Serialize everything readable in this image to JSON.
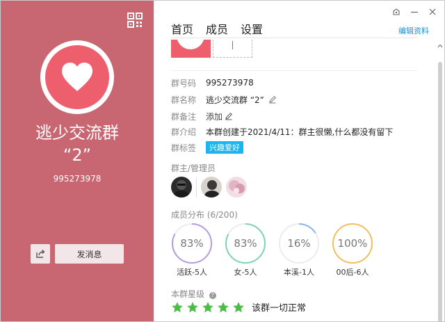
{
  "left": {
    "group_name": "逃少交流群\n“2”",
    "group_id": "995273978",
    "send_message_label": "发消息",
    "panel_color": "#c86671",
    "avatar_color": "#ee5f6e"
  },
  "window": {
    "controls": [
      "skin-icon",
      "minimize-icon",
      "close-icon"
    ]
  },
  "tabs": [
    {
      "label": "首页",
      "active": true
    },
    {
      "label": "成员",
      "active": false
    },
    {
      "label": "设置",
      "active": false
    }
  ],
  "edit_profile_label": "编辑资料",
  "info": {
    "group_id_label": "群号码",
    "group_id_value": "995273978",
    "group_name_label": "群名称",
    "group_name_value": "逃少交流群 “2”",
    "remark_label": "群备注",
    "remark_value": "添加",
    "intro_label": "群介绍",
    "intro_value": "本群创建于2021/4/11：群主很懒,什么都没有留下",
    "tag_label": "群标签",
    "tag_value": "兴趣爱好",
    "tag_color": "#1eb4ee"
  },
  "admins_title": "群主/管理员",
  "distribution": {
    "title": "成员分布 (6/200)",
    "items": [
      {
        "percent": "83%",
        "caption": "活跃-5人",
        "fraction": 0.83,
        "color": "#b39ddb"
      },
      {
        "percent": "83%",
        "caption": "女-5人",
        "fraction": 0.83,
        "color": "#7fd3b5"
      },
      {
        "percent": "16%",
        "caption": "本溪-1人",
        "fraction": 0.16,
        "color": "#8ab4f0"
      },
      {
        "percent": "100%",
        "caption": "00后-6人",
        "fraction": 1.0,
        "color": "#f0c060"
      }
    ]
  },
  "rating": {
    "title": "本群星级",
    "stars": 5,
    "star_color": "#4cbb47",
    "status": "该群一切正常"
  }
}
